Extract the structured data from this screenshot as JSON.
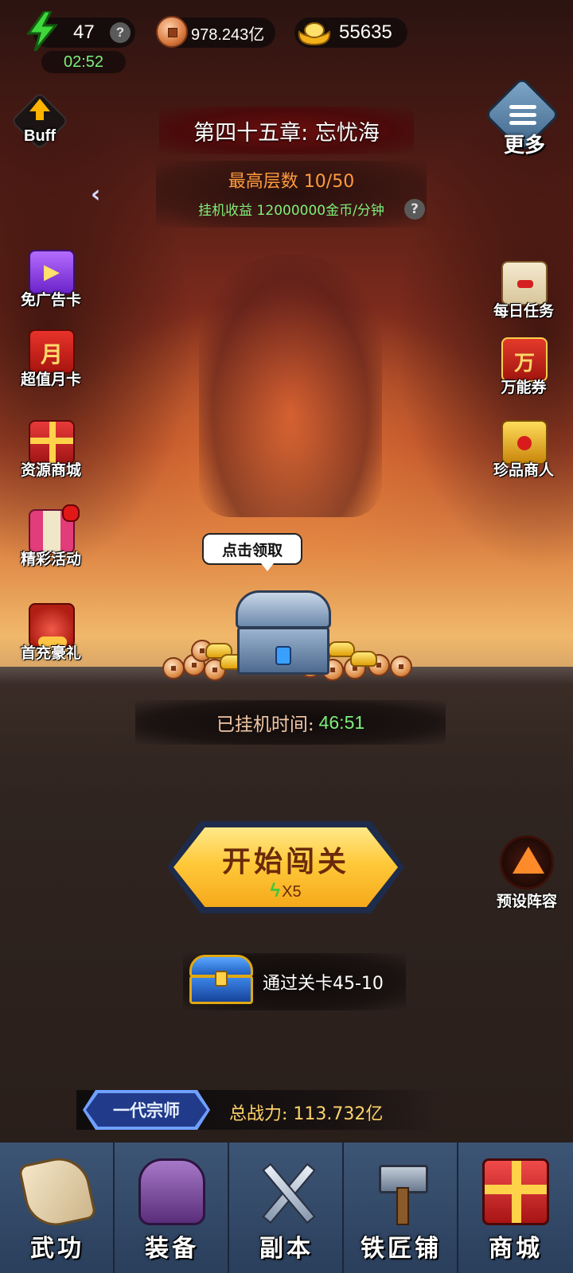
{
  "resources": {
    "energy": "47",
    "energy_help": "?",
    "energy_timer": "02:52",
    "copper": "978.243亿",
    "gold": "55635"
  },
  "buff_label": "Buff",
  "more_label": "更多",
  "chapter": {
    "title": "第四十五章: 忘忧海",
    "max_floor": "最高层数 10/50",
    "idle_income": "挂机收益 12000000金币/分钟",
    "income_help": "?",
    "back_icon": "‹"
  },
  "left_menu": [
    {
      "label": "免广告卡",
      "icon": "no-ad-card-icon"
    },
    {
      "label": "超值月卡",
      "icon": "monthly-card-icon"
    },
    {
      "label": "资源商城",
      "icon": "resource-shop-gift-icon"
    },
    {
      "label": "精彩活动",
      "icon": "events-icon"
    },
    {
      "label": "首充豪礼",
      "icon": "first-recharge-bag-icon"
    }
  ],
  "right_menu": [
    {
      "label": "每日任务",
      "icon": "daily-task-scroll-icon"
    },
    {
      "label": "万能券",
      "icon": "universal-voucher-icon"
    },
    {
      "label": "珍品商人",
      "icon": "treasure-merchant-icon"
    }
  ],
  "idle_chest": {
    "tooltip": "点击领取",
    "idle_time_label": "已挂机时间:",
    "idle_time_value": "46:51"
  },
  "start_button": {
    "label": "开始闯关",
    "cost": "X5"
  },
  "preset_lineup_label": "预设阵容",
  "reward": {
    "text": "通过关卡45-10"
  },
  "player": {
    "title": "一代宗师",
    "power_label": "总战力:",
    "power_value": "113.732亿"
  },
  "bottom_nav": [
    {
      "label": "武功",
      "icon": "martial-arts-scroll-icon"
    },
    {
      "label": "装备",
      "icon": "armor-icon"
    },
    {
      "label": "副本",
      "icon": "crossed-swords-icon"
    },
    {
      "label": "铁匠铺",
      "icon": "hammer-anvil-icon"
    },
    {
      "label": "商城",
      "icon": "gift-box-icon"
    }
  ]
}
